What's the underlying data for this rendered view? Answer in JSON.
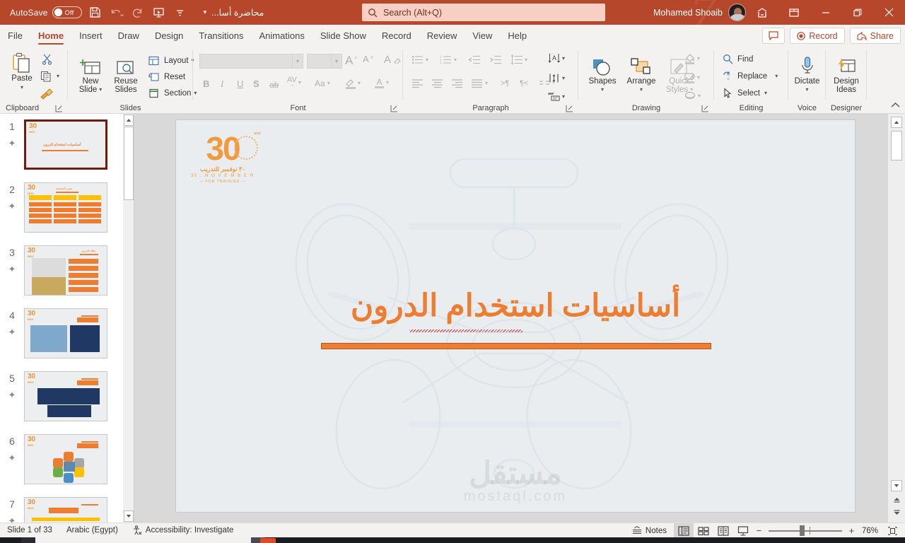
{
  "titlebar": {
    "autosave_label": "AutoSave",
    "autosave_state": "Off",
    "filename": "محاضرة أسا...",
    "user_name": "Mohamed Shoaib",
    "watermark": "7",
    "icons": [
      "save-icon",
      "undo-icon",
      "redo-icon",
      "start-presentation-icon",
      "customize-qat-icon"
    ]
  },
  "search": {
    "placeholder": "Search (Alt+Q)",
    "value": ""
  },
  "window_controls": {
    "ribbon_display_options": "ribbon-display-options-icon",
    "minimize": "minimize-icon",
    "restore": "restore-icon",
    "close": "close-icon"
  },
  "tabs": [
    {
      "label": "File",
      "active": false
    },
    {
      "label": "Home",
      "active": true
    },
    {
      "label": "Insert",
      "active": false
    },
    {
      "label": "Draw",
      "active": false
    },
    {
      "label": "Design",
      "active": false
    },
    {
      "label": "Transitions",
      "active": false
    },
    {
      "label": "Animations",
      "active": false
    },
    {
      "label": "Slide Show",
      "active": false
    },
    {
      "label": "Record",
      "active": false
    },
    {
      "label": "Review",
      "active": false
    },
    {
      "label": "View",
      "active": false
    },
    {
      "label": "Help",
      "active": false
    }
  ],
  "tabbar_right": {
    "comments_label": "",
    "record_label": "Record",
    "share_label": "Share"
  },
  "ribbon": {
    "clipboard": {
      "group_label": "Clipboard",
      "paste_label": "Paste",
      "cut_label": "",
      "copy_label": "",
      "format_painter_label": ""
    },
    "slides": {
      "group_label": "Slides",
      "new_slide_label": "New\nSlide",
      "new_slide_line1": "New",
      "new_slide_line2": "Slide",
      "reuse_slides_line1": "Reuse",
      "reuse_slides_line2": "Slides",
      "layout_label": "Layout",
      "reset_label": "Reset",
      "section_label": "Section"
    },
    "font": {
      "group_label": "Font",
      "font_name_value": "",
      "font_size_value": "",
      "grow_font": "A",
      "shrink_font": "A",
      "clear_formatting": "A",
      "bold": "B",
      "italic": "I",
      "underline": "U",
      "shadow": "S",
      "strikethrough": "ab",
      "char_spacing": "AV",
      "change_case": "Aa",
      "highlight": "",
      "font_color": "A",
      "disabled": true
    },
    "paragraph": {
      "group_label": "Paragraph",
      "disabled": true
    },
    "drawing": {
      "group_label": "Drawing",
      "shapes_label": "Shapes",
      "arrange_label": "Arrange",
      "quick_styles_line1": "Quick",
      "quick_styles_line2": "Styles"
    },
    "editing": {
      "group_label": "Editing",
      "find_label": "Find",
      "replace_label": "Replace",
      "select_label": "Select"
    },
    "voice": {
      "group_label": "Voice",
      "dictate_label": "Dictate"
    },
    "designer": {
      "group_label": "Designer",
      "design_ideas_line1": "Design",
      "design_ideas_line2": "Ideas"
    },
    "collapse_label": "^"
  },
  "thumbnails": [
    {
      "number": "1",
      "selected": true
    },
    {
      "number": "2",
      "selected": false
    },
    {
      "number": "3",
      "selected": false
    },
    {
      "number": "4",
      "selected": false
    },
    {
      "number": "5",
      "selected": false
    },
    {
      "number": "6",
      "selected": false
    },
    {
      "number": "7",
      "selected": false
    }
  ],
  "slide": {
    "logo": {
      "number": "30",
      "badge": "NOV",
      "arabic": "٣٠ نوفمبر للتدريب",
      "english": "30 . N O V E M B E R",
      "tagline": "FOR TRAINING"
    },
    "title": "أساسيات استخدام الدرون",
    "watermark_arabic": "مستقل",
    "watermark_english": "mostaql.com",
    "accent_color": "#ed7d31",
    "background": "#e9edf0"
  },
  "statusbar": {
    "slide_count": "Slide 1 of 33",
    "language": "Arabic (Egypt)",
    "accessibility": "Accessibility: Investigate",
    "notes_label": "Notes",
    "zoom_percent": "76%",
    "views": [
      "normal-view",
      "slide-sorter-view",
      "reading-view",
      "slide-show-view"
    ]
  }
}
